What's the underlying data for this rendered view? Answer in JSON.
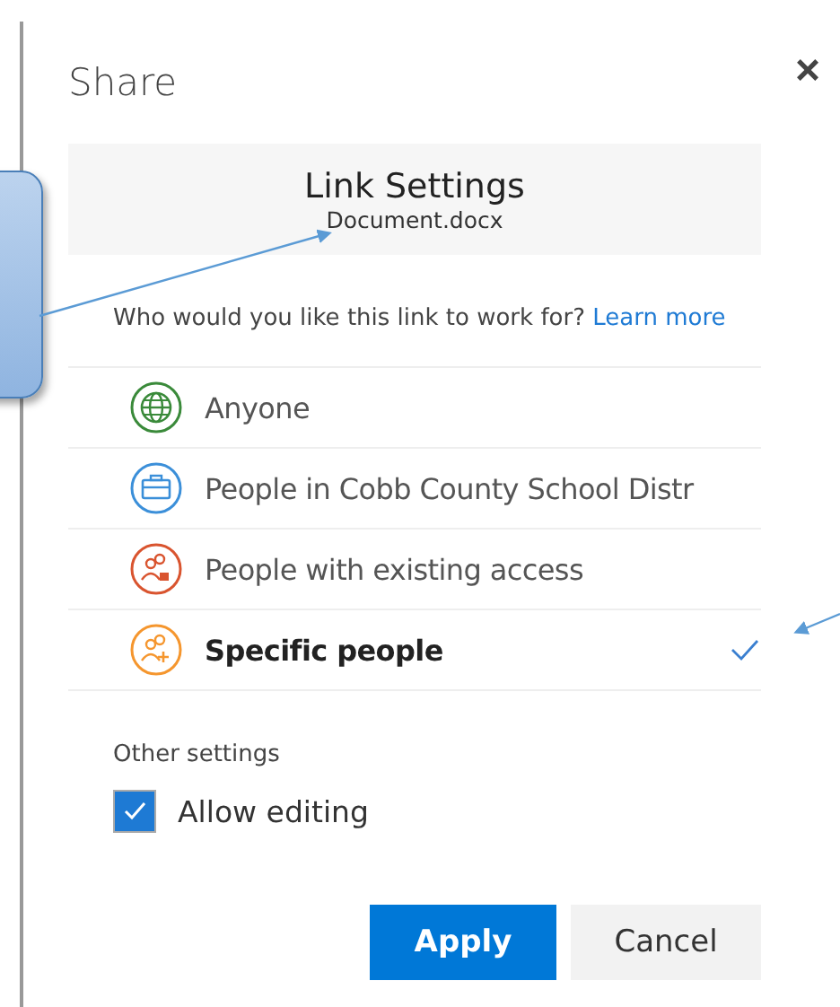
{
  "dialog": {
    "title": "Share",
    "close": "×"
  },
  "header": {
    "title": "Link Settings",
    "file": "Document.docx"
  },
  "question": {
    "text": "Who would you like this link to work for?",
    "link": "Learn more"
  },
  "options": [
    {
      "label": "Anyone",
      "kind": "globe",
      "color": "#3a8a3a",
      "selected": false
    },
    {
      "label": "People in Cobb County School Distr",
      "kind": "briefcase",
      "color": "#3b8fd9",
      "selected": false
    },
    {
      "label": "People with existing access",
      "kind": "lock",
      "color": "#d9542f",
      "selected": false
    },
    {
      "label": "Specific people",
      "kind": "add",
      "color": "#f5962e",
      "selected": true
    }
  ],
  "other_settings": {
    "heading": "Other settings",
    "checkbox": {
      "label": "Allow editing",
      "checked": true
    }
  },
  "buttons": [
    {
      "label": "Apply",
      "kind": "primary"
    },
    {
      "label": "Cancel",
      "kind": "secondary"
    }
  ]
}
